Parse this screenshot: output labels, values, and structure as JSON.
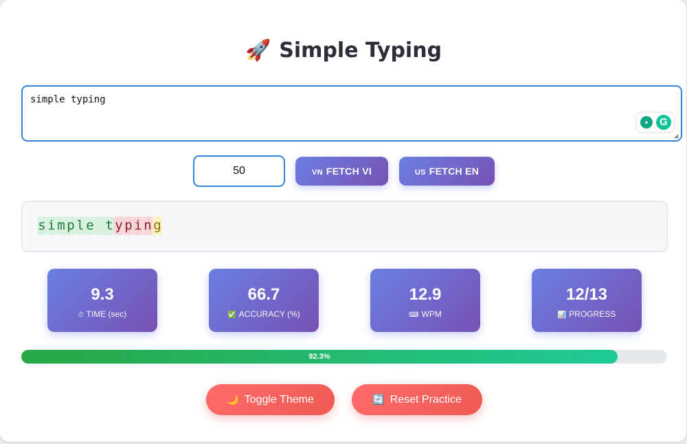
{
  "header": {
    "title": "Simple Typing",
    "icon": "rocket-icon"
  },
  "input_area": {
    "value": "simple typing"
  },
  "controls": {
    "count_value": "50",
    "fetch_vi_flag": "VN",
    "fetch_vi_label": "FETCH VI",
    "fetch_en_flag": "US",
    "fetch_en_label": "FETCH EN"
  },
  "display": {
    "chars": [
      {
        "char": "s",
        "state": "correct"
      },
      {
        "char": "i",
        "state": "correct"
      },
      {
        "char": "m",
        "state": "correct"
      },
      {
        "char": "p",
        "state": "correct"
      },
      {
        "char": "l",
        "state": "correct"
      },
      {
        "char": "e",
        "state": "correct"
      },
      {
        "char": " ",
        "state": "correct"
      },
      {
        "char": "t",
        "state": "correct"
      },
      {
        "char": "y",
        "state": "wrong"
      },
      {
        "char": "p",
        "state": "wrong"
      },
      {
        "char": "i",
        "state": "wrong"
      },
      {
        "char": "n",
        "state": "wrong"
      },
      {
        "char": "g",
        "state": "current"
      }
    ]
  },
  "stats": [
    {
      "value": "9.3",
      "icon": "stopwatch-icon",
      "label": "TIME (sec)"
    },
    {
      "value": "66.7",
      "icon": "checkmark-icon",
      "label": "ACCURACY (%)"
    },
    {
      "value": "12.9",
      "icon": "keyboard-icon",
      "label": "WPM"
    },
    {
      "value": "12/13",
      "icon": "chart-icon",
      "label": "PROGRESS"
    }
  ],
  "progress": {
    "percent": 92.3,
    "label": "92.3%"
  },
  "actions": {
    "toggle_theme_label": "Toggle Theme",
    "toggle_theme_icon": "moon-icon",
    "reset_label": "Reset Practice",
    "reset_icon": "refresh-icon"
  },
  "colors": {
    "accent_gradient_start": "#6b7fe3",
    "accent_gradient_end": "#7751b3",
    "progress_start": "#28a745",
    "progress_end": "#20c997",
    "danger_start": "#ff6b6b",
    "danger_end": "#ee5a52",
    "focus_border": "#2f86de"
  }
}
